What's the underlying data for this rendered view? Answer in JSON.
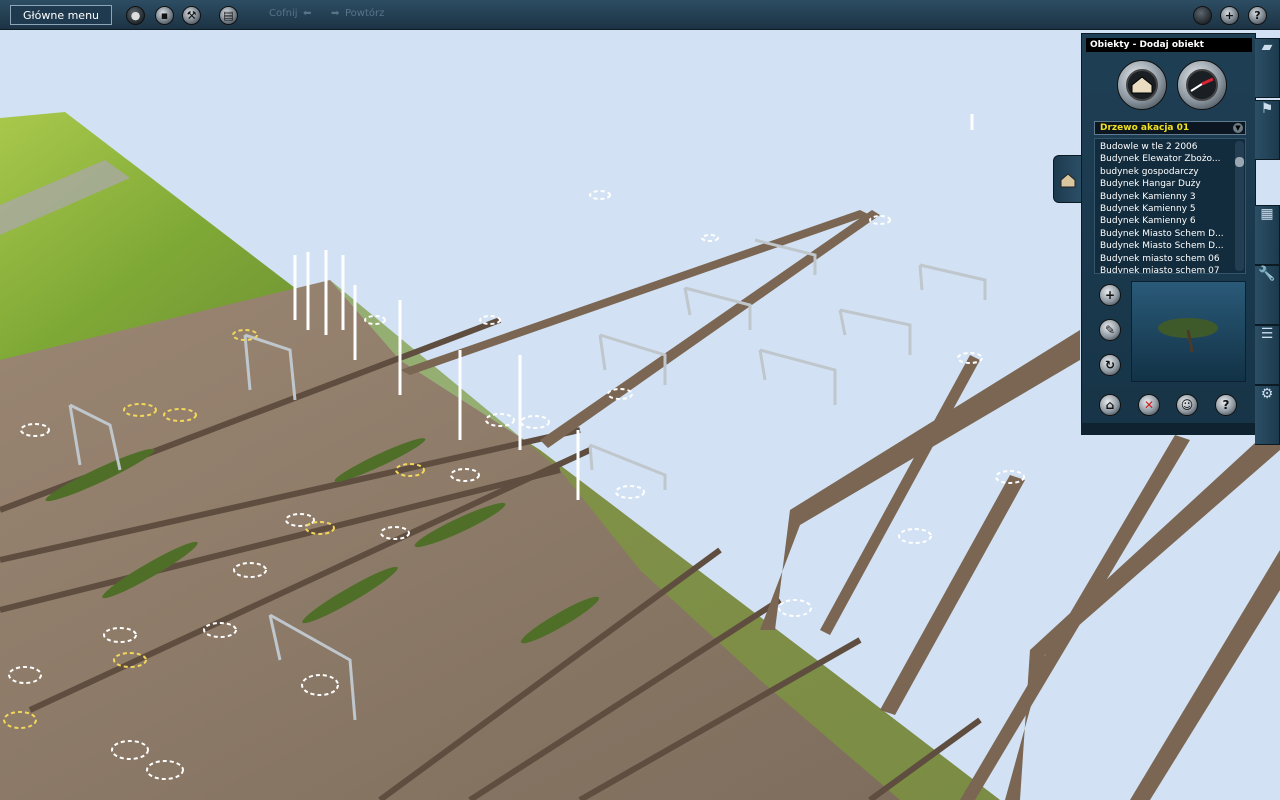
{
  "toolbar": {
    "main_menu": "Główne menu",
    "undo": "Cofnij",
    "redo": "Powtórz"
  },
  "panel": {
    "title": "Obiekty - Dodaj obiekt",
    "tree_select": "Drzewo akacja 01",
    "objects": [
      "Budowle w tle 2 2006",
      "Budynek Elewator Zbożo...",
      "budynek gospodarczy",
      "Budynek Hangar Duży",
      "Budynek Kamienny 3",
      "Budynek Kamienny 5",
      "Budynek Kamienny 6",
      "Budynek Miasto Schem D...",
      "Budynek Miasto Schem D...",
      "Budynek miasto schem 06",
      "Budynek miasto schem 07"
    ]
  },
  "colors": {
    "sky": "#cfe0f2",
    "toolbar": "#1f3a4e",
    "tree_select_text": "#f0e020",
    "grass": "#8fb83a",
    "dirt": "#8e7a66",
    "track": "#6a5848"
  }
}
